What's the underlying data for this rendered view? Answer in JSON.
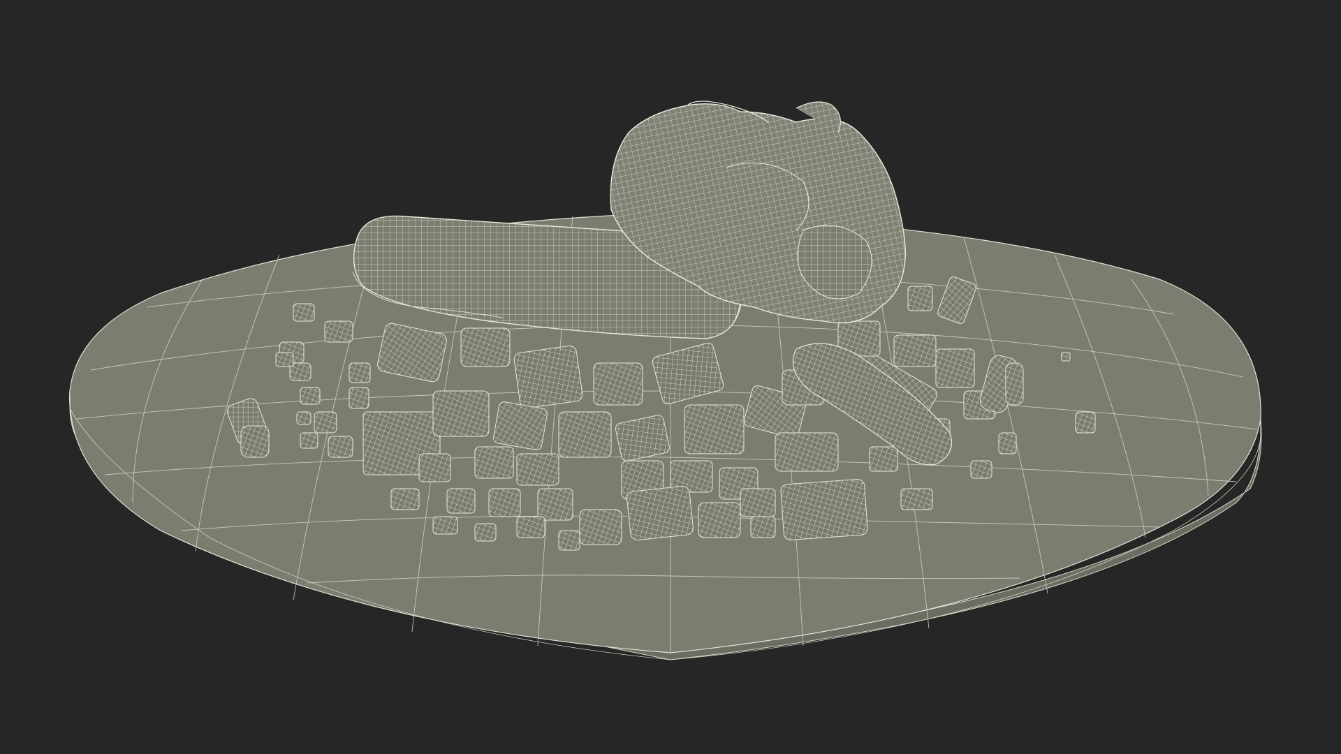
{
  "scene": {
    "description_visible_text": "",
    "colors": {
      "background": "#262626",
      "mesh_fill": "#7b7b70",
      "mesh_fill_light": "#8a8a7e",
      "wire": "#e6e6d8",
      "wire_dim": "#c9c9bb"
    },
    "objects": [
      {
        "name": "plate",
        "kind": "oval platter"
      },
      {
        "name": "sausage",
        "kind": "cylindrical food mesh"
      },
      {
        "name": "roast-chunk",
        "kind": "irregular food mesh"
      },
      {
        "name": "diced-vegetables",
        "kind": "scattered cube meshes"
      }
    ]
  }
}
